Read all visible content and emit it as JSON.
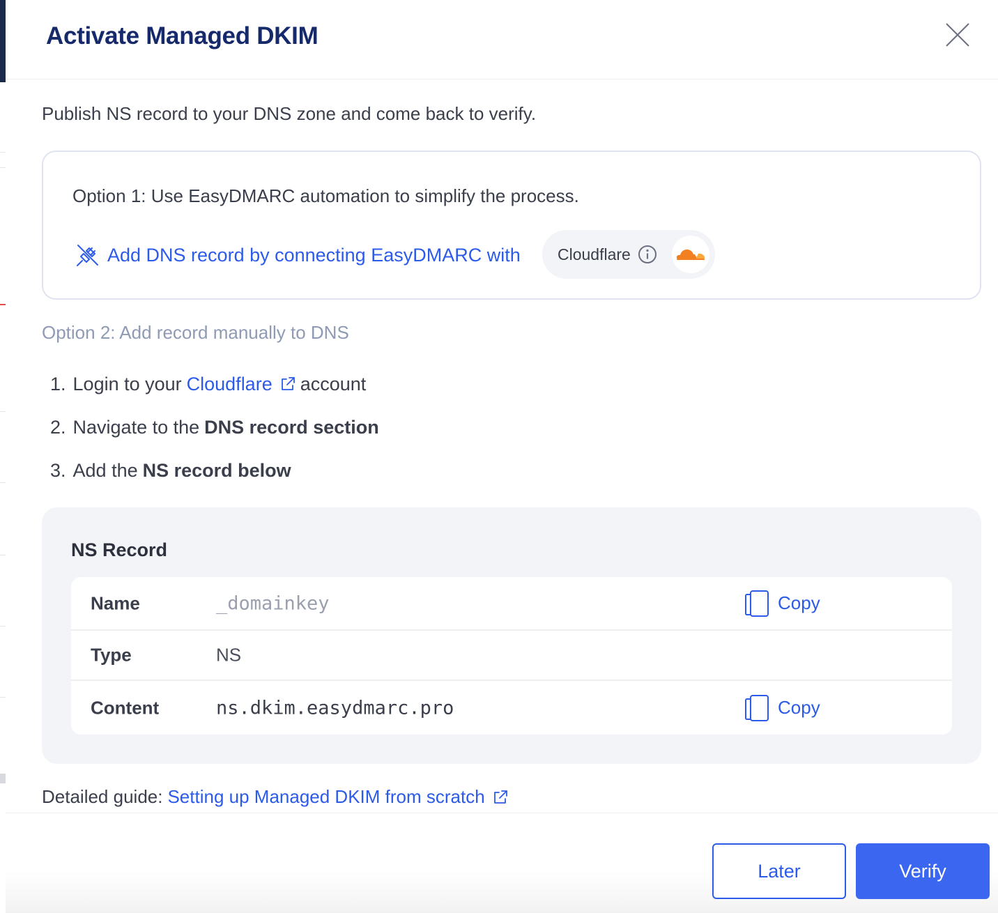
{
  "modal": {
    "title": "Activate Managed DKIM",
    "intro": "Publish NS record to your DNS zone and come back to verify."
  },
  "option1": {
    "text": "Option 1: Use EasyDMARC automation to simplify the process.",
    "connect_label": "Add DNS record by connecting EasyDMARC with",
    "provider_name": "Cloudflare"
  },
  "option2": {
    "heading": "Option 2: Add record manually to DNS",
    "steps": [
      {
        "num": "1.",
        "prefix": "Login to your",
        "link": "Cloudflare",
        "suffix": "account"
      },
      {
        "num": "2.",
        "prefix": "Navigate to the",
        "bold": "DNS record section"
      },
      {
        "num": "3.",
        "prefix": "Add the",
        "bold": "NS record below"
      }
    ]
  },
  "record": {
    "title": "NS Record",
    "rows": [
      {
        "key": "Name",
        "value": "_domainkey",
        "copy": "Copy"
      },
      {
        "key": "Type",
        "value": "NS"
      },
      {
        "key": "Content",
        "value": "ns.dkim.easydmarc.pro",
        "copy": "Copy"
      }
    ]
  },
  "guide": {
    "prefix": "Detailed guide:",
    "link": "Setting up Managed DKIM from scratch"
  },
  "footer": {
    "later": "Later",
    "verify": "Verify"
  },
  "colors": {
    "title": "#162a6b",
    "link": "#2b5be8",
    "primary_button": "#3b66ef",
    "muted": "#8f9ab5",
    "cloudflare_orange": "#f38020"
  },
  "icons": [
    "close-icon",
    "unplugged-icon",
    "info-icon",
    "cloudflare-logo-icon",
    "external-link-icon",
    "copy-icon"
  ]
}
